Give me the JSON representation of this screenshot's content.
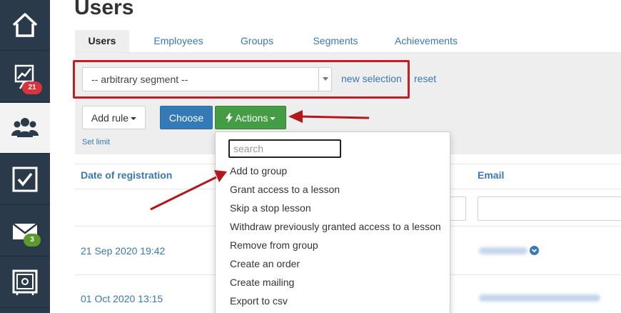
{
  "page": {
    "title": "Users"
  },
  "sidebar": {
    "items": [
      {
        "icon": "home-icon"
      },
      {
        "icon": "chart-board-icon",
        "badge": "21",
        "badge_color": "#d9343b"
      },
      {
        "icon": "users-icon",
        "active": true
      },
      {
        "icon": "checkbox-icon"
      },
      {
        "icon": "mail-icon",
        "badge": "3",
        "badge_color": "#5c9a2c"
      },
      {
        "icon": "safe-icon"
      }
    ]
  },
  "tabs": [
    {
      "label": "Users",
      "active": true
    },
    {
      "label": "Employees"
    },
    {
      "label": "Groups"
    },
    {
      "label": "Segments"
    },
    {
      "label": "Achievements"
    }
  ],
  "filters": {
    "segment_value": "-- arbitrary segment --",
    "new_selection": "new selection",
    "reset": "reset",
    "add_rule": "Add rule",
    "choose": "Choose",
    "actions": "Actions",
    "set_limit": "Set limit"
  },
  "actions_menu": {
    "search_placeholder": "search",
    "items": [
      "Add to group",
      "Grant access to a lesson",
      "Skip a stop lesson",
      "Withdraw previously granted access to a lesson",
      "Remove from group",
      "Create an order",
      "Create mailing",
      "Export to csv"
    ]
  },
  "table": {
    "columns": {
      "date": "Date of registration",
      "email": "Email"
    },
    "rows": [
      {
        "date": "21 Sep 2020 19:42"
      },
      {
        "date": "01 Oct 2020 13:15"
      }
    ]
  },
  "colors": {
    "sidebar_bg": "#2a3a4a",
    "link_blue": "#3a78b5",
    "choose_blue": "#337ab7",
    "actions_green": "#449d44",
    "annotation_red": "#c41e24"
  }
}
